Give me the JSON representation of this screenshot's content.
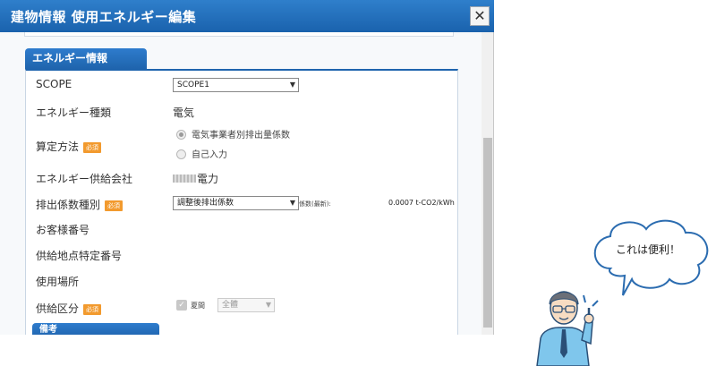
{
  "dialog": {
    "title": "建物情報 使用エネルギー編集",
    "close_label": "✕"
  },
  "section": {
    "tab_label": "エネルギー情報",
    "required_badge": "必須"
  },
  "fields": {
    "scope_label": "SCOPE",
    "scope_value": "SCOPE1",
    "energy_type_label": "エネルギー種類",
    "energy_type_value": "電気",
    "calc_method_label": "算定方法",
    "calc_options": [
      "電気事業者別排出量係数",
      "自己入力"
    ],
    "calc_selected_index": 0,
    "supplier_label": "エネルギー供給会社",
    "supplier_value": "電力",
    "emission_type_label": "排出係数種別",
    "emission_type_value": "調整後排出係数",
    "coef_label": "係数(最新):",
    "coef_value": "0.0007 t-CO2/kWh",
    "customer_no_label": "お客様番号",
    "supply_point_label": "供給地点特定番号",
    "use_place_label": "使用場所",
    "supply_class_label": "供給区分",
    "supply_class_check_label": "夏間",
    "supply_class_select_value": "全體",
    "supply_class_checked": true
  },
  "remarks_tab_label": "備考",
  "speech_bubble_text": "これは便利！",
  "colors": {
    "title_bar": "#1a62ad",
    "required_badge": "#f29a2e"
  }
}
